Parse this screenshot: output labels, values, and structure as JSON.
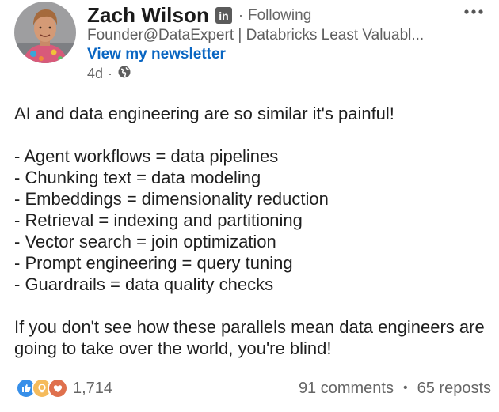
{
  "author": {
    "name": "Zach Wilson",
    "badge": "in",
    "separator": "·",
    "follow_status": "Following",
    "headline": "Founder@DataExpert | Databricks Least Valuabl...",
    "newsletter_link": "View my newsletter",
    "time": "4d",
    "time_separator": "·",
    "visibility_icon": "globe-icon"
  },
  "menu": {
    "icon": "more-horizontal-icon"
  },
  "post": {
    "intro": "AI and data engineering are so similar it's painful!",
    "items": [
      "- Agent workflows = data pipelines",
      "- Chunking text = data modeling",
      "- Embeddings = dimensionality reduction",
      "- Retrieval = indexing and partitioning",
      "- Vector search = join optimization",
      "- Prompt engineering = query tuning",
      "- Guardrails = data quality checks"
    ],
    "closing": "If you don't see how these parallels mean data engineers are going to take over the world, you're blind!"
  },
  "social": {
    "reaction_icons": [
      "like-icon",
      "insightful-icon",
      "love-icon"
    ],
    "reaction_count": "1,714",
    "comments": "91 comments",
    "separator": "•",
    "reposts": "65 reposts"
  },
  "colors": {
    "link_blue": "#0a66c2",
    "muted_text": "#666666",
    "like_blue": "#378fe9",
    "insightful_yellow": "#f5bb5c",
    "love_red": "#df704d"
  }
}
